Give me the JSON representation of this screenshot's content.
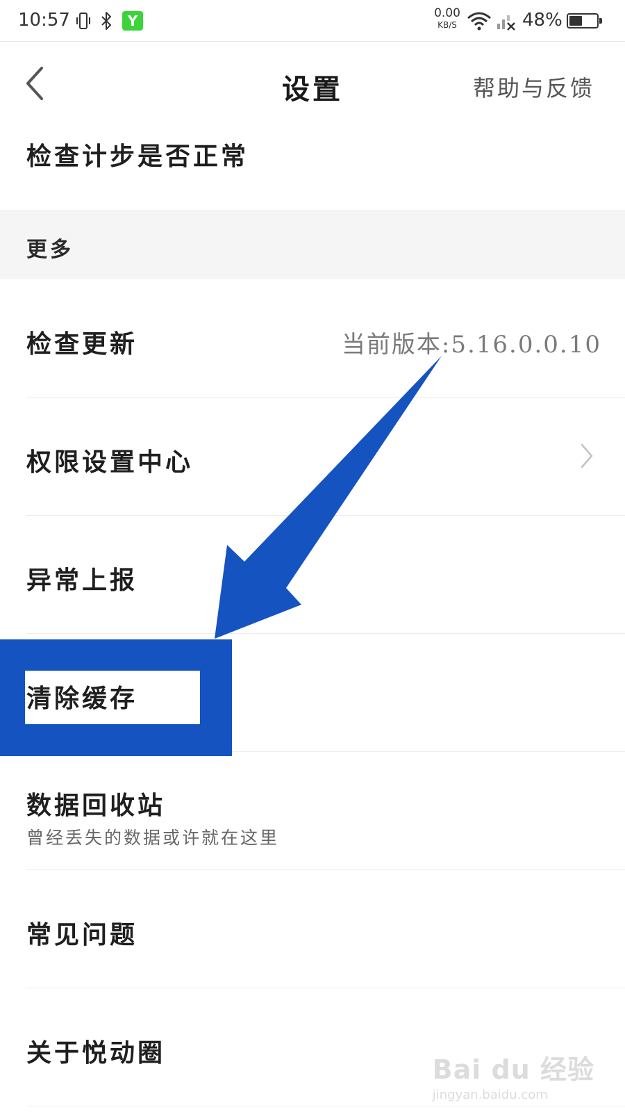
{
  "status_bar": {
    "time": "10:57",
    "net_speed_value": "0.00",
    "net_speed_unit": "KB/S",
    "battery_percent": "48%",
    "battery_level": 0.48,
    "app_icon_letter": "Y"
  },
  "header": {
    "title": "设置",
    "help_label": "帮助与反馈"
  },
  "rows": {
    "check_steps": {
      "label": "检查计步是否正常"
    },
    "section_more": {
      "label": "更多"
    },
    "check_update": {
      "label": "检查更新",
      "value": "当前版本:5.16.0.0.10"
    },
    "permissions": {
      "label": "权限设置中心"
    },
    "report": {
      "label": "异常上报"
    },
    "clear_cache": {
      "label": "清除缓存"
    },
    "recycle_bin": {
      "label": "数据回收站",
      "sub": "曾经丢失的数据或许就在这里"
    },
    "faq": {
      "label": "常见问题"
    },
    "about": {
      "label": "关于悦动圈"
    }
  },
  "annotation": {
    "color": "#1553c1"
  },
  "watermark": {
    "brand": "Bai du 经验",
    "url": "jingyan.baidu.com"
  },
  "colors": {
    "divider": "#ececec",
    "section_bg": "#f5f5f5",
    "app_icon": "#3bd43b"
  }
}
